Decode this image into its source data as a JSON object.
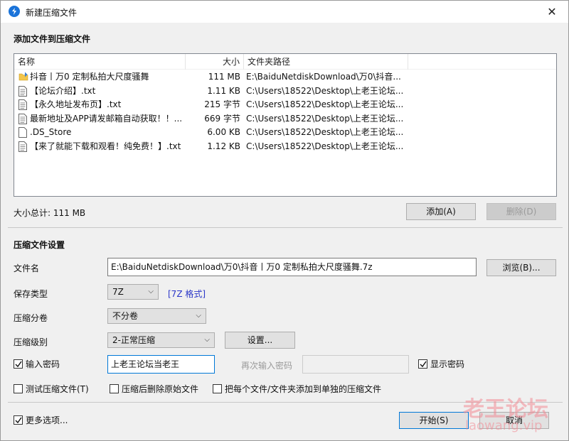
{
  "window": {
    "title": "新建压缩文件",
    "close_glyph": "✕"
  },
  "add_section": {
    "title": "添加文件到压缩文件"
  },
  "file_list": {
    "columns": {
      "name": "名称",
      "size": "大小",
      "path": "文件夹路径"
    },
    "rows": [
      {
        "name": "抖音丨万0 定制私拍大尺度骚舞",
        "size": "111 MB",
        "path": "E:\\BaiduNetdiskDownload\\万0\\抖音...",
        "icon": "folder-icon"
      },
      {
        "name": "【论坛介绍】.txt",
        "size": "1.11 KB",
        "path": "C:\\Users\\18522\\Desktop\\上老王论坛...",
        "icon": "text-file-icon"
      },
      {
        "name": "【永久地址发布页】.txt",
        "size": "215 字节",
        "path": "C:\\Users\\18522\\Desktop\\上老王论坛...",
        "icon": "text-file-icon"
      },
      {
        "name": "最新地址及APP请发邮箱自动获取！！...",
        "size": "669 字节",
        "path": "C:\\Users\\18522\\Desktop\\上老王论坛...",
        "icon": "text-file-icon"
      },
      {
        "name": ".DS_Store",
        "size": "6.00 KB",
        "path": "C:\\Users\\18522\\Desktop\\上老王论坛...",
        "icon": "blank-file-icon"
      },
      {
        "name": "【来了就能下载和观看！纯免费！】.txt",
        "size": "1.12 KB",
        "path": "C:\\Users\\18522\\Desktop\\上老王论坛...",
        "icon": "text-file-icon"
      }
    ]
  },
  "summary": {
    "total_size": "大小总计: 111 MB"
  },
  "buttons": {
    "add": "添加(A)",
    "remove": "删除(D)",
    "browse": "浏览(B)...",
    "settings": "设置...",
    "start": "开始(S)",
    "cancel": "取消"
  },
  "settings_section": {
    "title": "压缩文件设置"
  },
  "fields": {
    "filename_label": "文件名",
    "filename_value": "E:\\BaiduNetdiskDownload\\万0\\抖音丨万0 定制私拍大尺度骚舞.7z",
    "save_type_label": "保存类型",
    "save_type_value": "7Z",
    "save_type_link": "[7Z 格式]",
    "split_label": "压缩分卷",
    "split_value": "不分卷",
    "level_label": "压缩级别",
    "level_value": "2-正常压缩",
    "password_label": "输入密码",
    "password_value": "上老王论坛当老王",
    "reenter_label": "再次输入密码",
    "show_password_label": "显示密码"
  },
  "options": {
    "test": "测试压缩文件(T)",
    "delete_after": "压缩后删除原始文件",
    "separate": "把每个文件/文件夹添加到单独的压缩文件",
    "more": "更多选项..."
  },
  "watermark": {
    "text": "老王论坛",
    "url": "laowang.vip"
  },
  "colors": {
    "accent": "#0078d7",
    "link": "#2b37c8",
    "watermark": "#f28b95"
  }
}
